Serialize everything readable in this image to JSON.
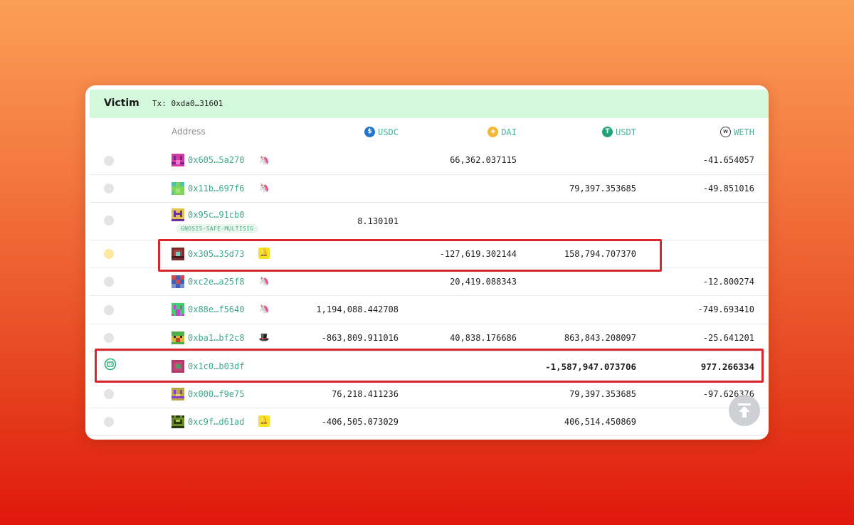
{
  "header": {
    "title": "Victim",
    "tx_label": "Tx: 0xda0…31601"
  },
  "columns": {
    "address": "Address",
    "usdc": "USDC",
    "dai": "DAI",
    "usdt": "USDT",
    "weth": "WETH"
  },
  "colors": {
    "usdc": "#2775ca",
    "dai": "#f4b731",
    "usdt": "#26a17b",
    "weth": "#3a3a3a",
    "highlight": "#d9262c",
    "address": "#3fa88c"
  },
  "rows": [
    {
      "address": "0x605…5a270",
      "icon": "unicorn-icon",
      "usdc": "",
      "dai": "66,362.037115",
      "usdt": "",
      "weth": "-41.654057"
    },
    {
      "address": "0x11b…697f6",
      "icon": "unicorn-icon",
      "usdc": "",
      "dai": "",
      "usdt": "79,397.353685",
      "weth": "-49.851016"
    },
    {
      "address": "0x95c…91cb0",
      "tag": "GNOSIS-SAFE-MULTISIG",
      "usdc": "8.130101",
      "dai": "",
      "usdt": "",
      "weth": ""
    },
    {
      "address": "0x305…35d73",
      "icon": "bell-icon",
      "usdc": "",
      "dai": "-127,619.302144",
      "usdt": "158,794.707370",
      "weth": ""
    },
    {
      "address": "0xc2e…a25f8",
      "icon": "unicorn-icon",
      "usdc": "",
      "dai": "20,419.088343",
      "usdt": "",
      "weth": "-12.800274"
    },
    {
      "address": "0x88e…f5640",
      "icon": "unicorn-icon",
      "usdc": "1,194,088.442708",
      "dai": "",
      "usdt": "",
      "weth": "-749.693410"
    },
    {
      "address": "0xba1…bf2c8",
      "icon": "hat-icon",
      "usdc": "-863,809.911016",
      "dai": "40,838.176686",
      "usdt": "863,843.208097",
      "weth": "-25.641201"
    },
    {
      "address": "0x1c0…b03df",
      "usdc": "",
      "dai": "",
      "usdt": "-1,587,947.073706",
      "weth": "977.266334"
    },
    {
      "address": "0x000…f9e75",
      "usdc": "76,218.411236",
      "dai": "",
      "usdt": "79,397.353685",
      "weth": "-97.626376"
    },
    {
      "address": "0xc9f…d61ad",
      "icon": "bell-icon",
      "usdc": "-406,505.073029",
      "dai": "",
      "usdt": "406,514.450869",
      "weth": ""
    }
  ]
}
